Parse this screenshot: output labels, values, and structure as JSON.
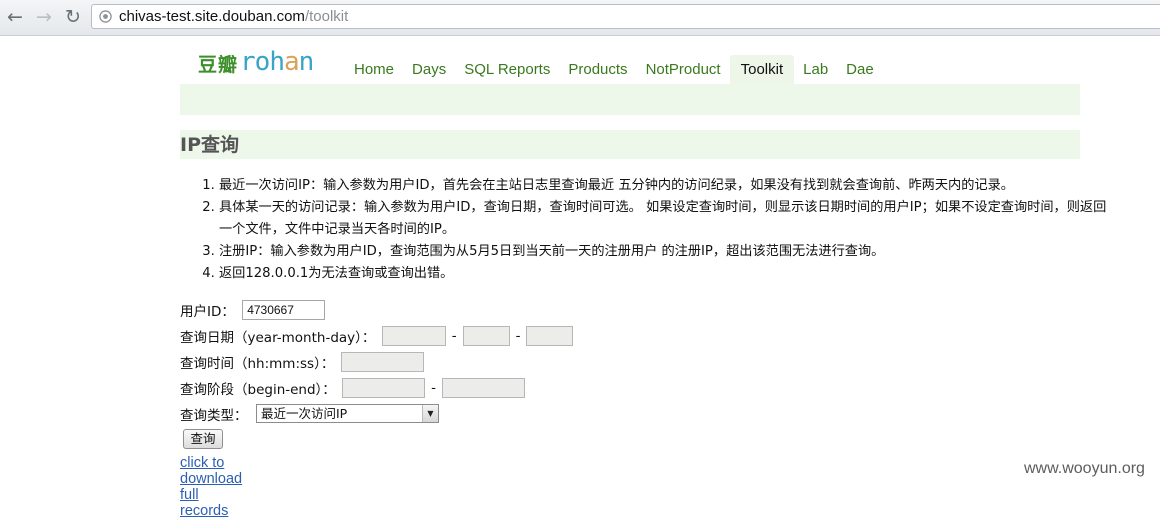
{
  "browser": {
    "url_host": "chivas-test.site.douban.com",
    "url_path": "/toolkit",
    "back_icon": "←",
    "forward_icon": "→",
    "reload_icon": "↻"
  },
  "logo": {
    "cn": "豆瓣",
    "latin": [
      "r",
      "o",
      "h",
      "a",
      "n"
    ]
  },
  "nav": {
    "items": [
      {
        "label": "Home"
      },
      {
        "label": "Days"
      },
      {
        "label": "SQL Reports"
      },
      {
        "label": "Products"
      },
      {
        "label": "NotProduct"
      },
      {
        "label": "Toolkit"
      },
      {
        "label": "Lab"
      },
      {
        "label": "Dae"
      }
    ],
    "active": "Toolkit"
  },
  "section": {
    "title": "IP查询"
  },
  "notes": [
    "最近一次访问IP：输入参数为用户ID，首先会在主站日志里查询最近 五分钟内的访问纪录，如果没有找到就会查询前、昨两天内的记录。",
    "具体某一天的访问记录：输入参数为用户ID，查询日期，查询时间可选。 如果设定查询时间，则显示该日期时间的用户IP；如果不设定查询时间，则返回一个文件，文件中记录当天各时间的IP。",
    "注册IP：输入参数为用户ID，查询范围为从5月5日到当天前一天的注册用户 的注册IP，超出该范围无法进行查询。",
    "返回128.0.0.1为无法查询或查询出错。"
  ],
  "form": {
    "user_id_label": "用户ID：",
    "user_id_value": "4730667",
    "date_label": "查询日期（year-month-day）：",
    "time_label": "查询时间（hh:mm:ss）：",
    "range_label": "查询阶段（begin-end）：",
    "type_label": "查询类型：",
    "type_selected": "最近一次访问IP",
    "separator": "-",
    "submit_label": "查询",
    "download_link": "click to download full records"
  },
  "watermark": "www.wooyun.org",
  "colors": {
    "logo_letters": [
      "#3aa3c8",
      "#3aa3c8",
      "#3aa3c8",
      "#d8a25a",
      "#3aa3c8"
    ]
  }
}
